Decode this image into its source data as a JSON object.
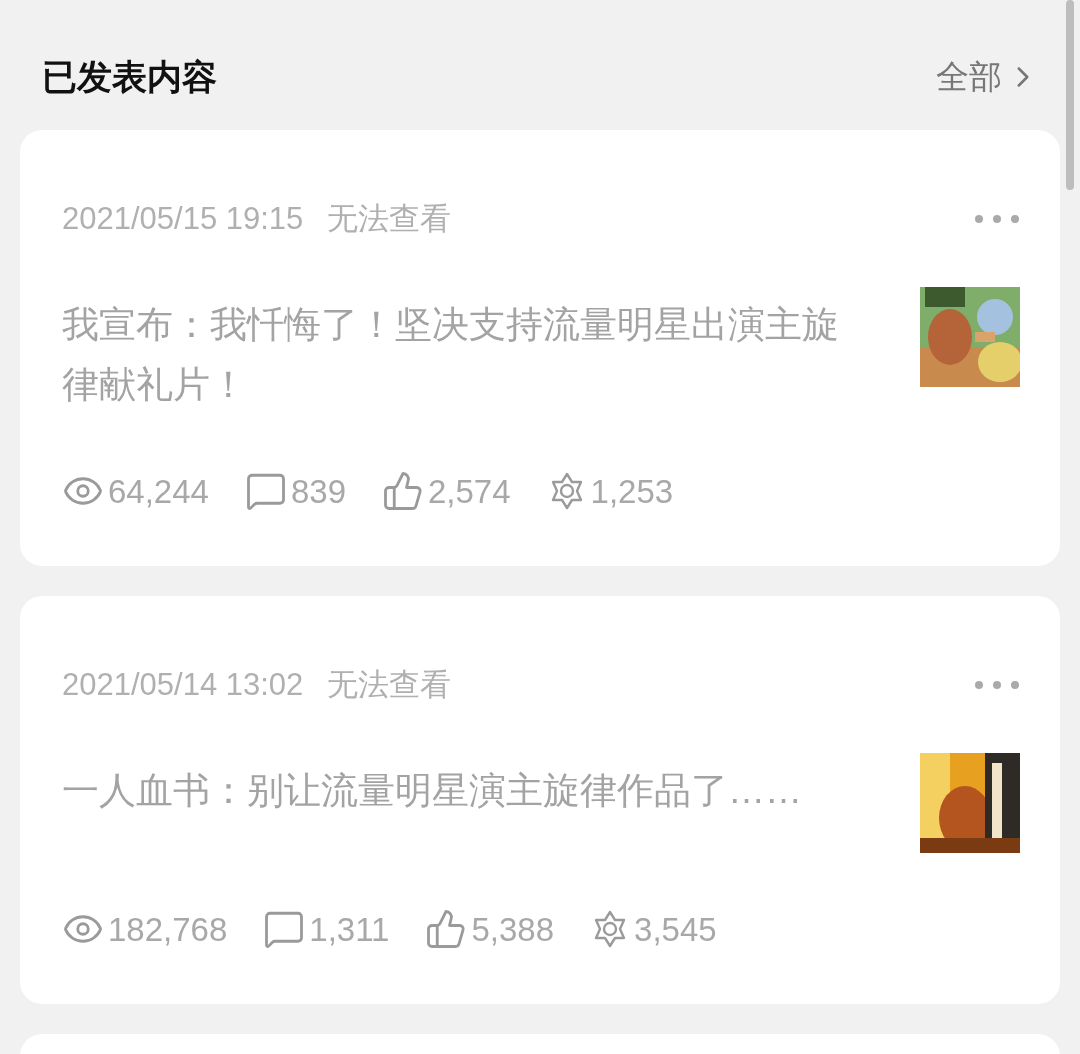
{
  "header": {
    "title": "已发表内容",
    "link": "全部"
  },
  "posts": [
    {
      "date": "2021/05/15 19:15",
      "status": "无法查看",
      "text": "我宣布：我忏悔了！坚决支持流量明星出演主旋律献礼片！",
      "stats": [
        {
          "kind": "views",
          "value": "64,244"
        },
        {
          "kind": "comments",
          "value": "839"
        },
        {
          "kind": "likes",
          "value": "2,574"
        },
        {
          "kind": "rewards",
          "value": "1,253"
        }
      ]
    },
    {
      "date": "2021/05/14 13:02",
      "status": "无法查看",
      "text": "一人血书：别让流量明星演主旋律作品了……",
      "stats": [
        {
          "kind": "views",
          "value": "182,768"
        },
        {
          "kind": "comments",
          "value": "1,311"
        },
        {
          "kind": "likes",
          "value": "5,388"
        },
        {
          "kind": "rewards",
          "value": "3,545"
        }
      ]
    }
  ]
}
